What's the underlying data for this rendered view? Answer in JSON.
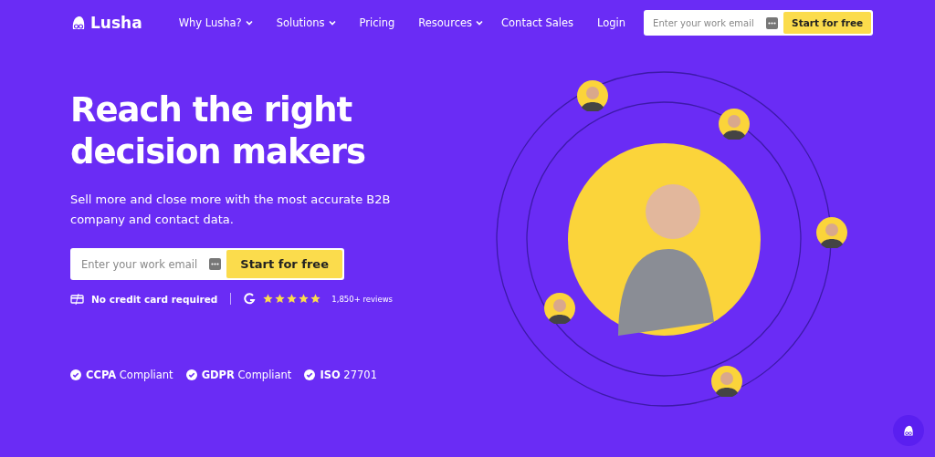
{
  "nav": {
    "brand": "Lusha",
    "links": [
      {
        "label": "Why Lusha?",
        "dropdown": true
      },
      {
        "label": "Solutions",
        "dropdown": true
      },
      {
        "label": "Pricing",
        "dropdown": false
      },
      {
        "label": "Resources",
        "dropdown": true
      }
    ],
    "right_links": [
      "Contact Sales",
      "Login"
    ],
    "signup": {
      "placeholder": "Enter your work email",
      "button": "Start for free"
    }
  },
  "hero": {
    "title": "Reach the right decision makers",
    "subtitle": "Sell more and close more with the most accurate B2B company and contact data.",
    "signup": {
      "placeholder": "Enter your work email",
      "button": "Start for free"
    },
    "no_card": "No credit card required",
    "stars": 5,
    "reviews": "1,850+ reviews",
    "compliance": [
      "**CCPA** Compliant",
      "**GDPR** Compliant",
      "**ISO** 27701"
    ]
  }
}
